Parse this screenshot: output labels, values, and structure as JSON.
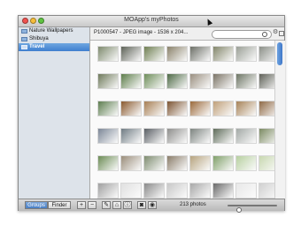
{
  "window": {
    "title": "MOApp's myPhotos"
  },
  "sidebar": {
    "items": [
      {
        "label": "Nature Wallpapers",
        "selected": false
      },
      {
        "label": "Shibuya",
        "selected": false
      },
      {
        "label": "Travel",
        "selected": true
      }
    ]
  },
  "infobar": {
    "text": "P1000547 - JPEG image - 1536 x 204...",
    "search_placeholder": ""
  },
  "photos": {
    "rows": [
      [
        "#7e8a6e",
        "#5d6257",
        "#6f7f52",
        "#8a826b",
        "#6c6f67",
        "#83866b",
        "#9a9f96",
        "#8b8f88"
      ],
      [
        "#6f7a5b",
        "#5d7d4a",
        "#6e8d5a",
        "#4e6a46",
        "#9a8f80",
        "#7b7466",
        "#6d7564",
        "#5f6158"
      ],
      [
        "#5e7e50",
        "#8a5a2f",
        "#a77f54",
        "#7d5533",
        "#9b6a3b",
        "#c0a07a",
        "#a78358",
        "#8f6a46"
      ],
      [
        "#7c8797",
        "#6f7b83",
        "#5a5f64",
        "#8e8e8c",
        "#7d8480",
        "#5f6c5a",
        "#a3a9a6",
        "#7b8a62"
      ],
      [
        "#6c8c55",
        "#9a8d7a",
        "#7e8c70",
        "#8a7d6a",
        "#b7a47f",
        "#80a06a",
        "#b7d0a0",
        "#c8d8b0"
      ],
      [
        "#a0a0a0",
        "#e0e0e0",
        "#8a8a8a",
        "#c8c8c8",
        "#a8a8a8",
        "#6a6a6a",
        "#e8e8e8",
        "#d0d0d0"
      ]
    ]
  },
  "toolbar": {
    "groups_label": "Groups",
    "finder_label": "Finder",
    "add_label": "+",
    "remove_label": "−",
    "count_text": "213 photos",
    "zoom_level": 0.2
  },
  "colors": {
    "selection": "#3f7fcf",
    "accent": "#5b8fd6"
  }
}
